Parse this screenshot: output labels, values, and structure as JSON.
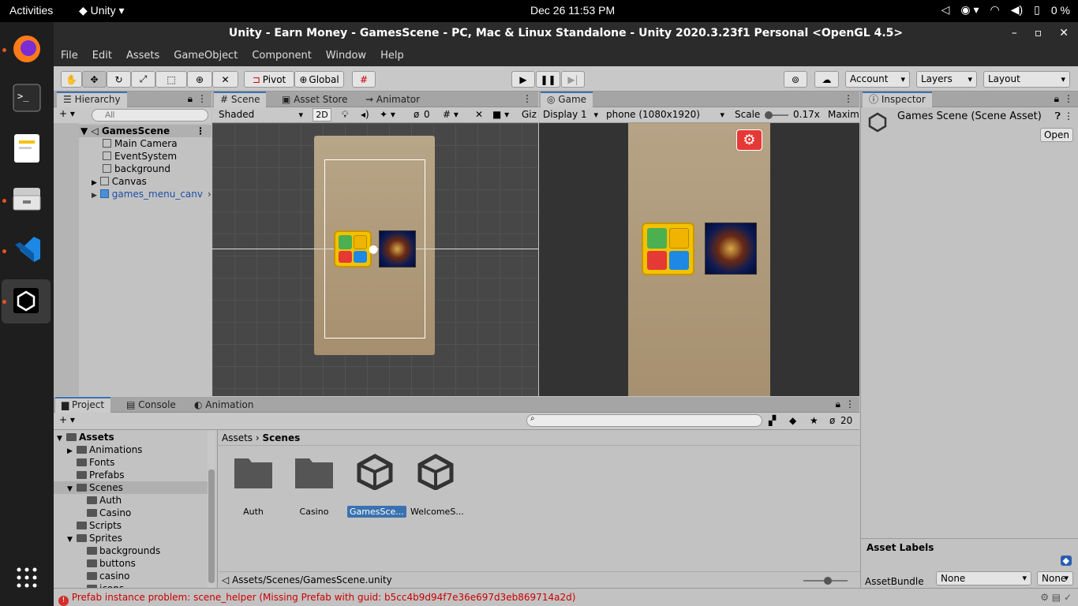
{
  "topbar": {
    "activities": "Activities",
    "app": "Unity",
    "clock": "Dec 26  11:53 PM",
    "battery": "0 %"
  },
  "window": {
    "title": "Unity - Earn Money - GamesScene - PC, Mac & Linux Standalone - Unity 2020.3.23f1 Personal <OpenGL 4.5>"
  },
  "menu": [
    "File",
    "Edit",
    "Assets",
    "GameObject",
    "Component",
    "Window",
    "Help"
  ],
  "toolbar": {
    "pivot": "Pivot",
    "global": "Global",
    "account": "Account",
    "layers": "Layers",
    "layout": "Layout"
  },
  "hierarchy": {
    "tab": "Hierarchy",
    "search_placeholder": "All",
    "scene": "GamesScene",
    "items": [
      "Main Camera",
      "EventSystem",
      "background",
      "Canvas",
      "games_menu_canv"
    ]
  },
  "scene": {
    "tabs": [
      "Scene",
      "Asset Store",
      "Animator"
    ],
    "shading": "Shaded",
    "mode2d": "2D",
    "hidden_count": "0",
    "gizmos": "Giz"
  },
  "game": {
    "tab": "Game",
    "display": "Display 1",
    "resolution": "phone (1080x1920)",
    "scale_label": "Scale",
    "scale_value": "0.17x",
    "maximize": "Maximi"
  },
  "inspector": {
    "tab": "Inspector",
    "title": "Games Scene (Scene Asset)",
    "open": "Open",
    "asset_labels": "Asset Labels",
    "asset_bundle": "AssetBundle",
    "bundle_value": "None",
    "variant_value": "None"
  },
  "project": {
    "tabs": [
      "Project",
      "Console",
      "Animation"
    ],
    "hidden_count": "20",
    "breadcrumb_root": "Assets",
    "breadcrumb_current": "Scenes",
    "path": "Assets/Scenes/GamesScene.unity",
    "tree": [
      {
        "label": "Assets",
        "indent": 0,
        "type": "open"
      },
      {
        "label": "Animations",
        "indent": 1,
        "type": "closed"
      },
      {
        "label": "Fonts",
        "indent": 1,
        "type": "leaf"
      },
      {
        "label": "Prefabs",
        "indent": 1,
        "type": "leaf"
      },
      {
        "label": "Scenes",
        "indent": 1,
        "type": "open"
      },
      {
        "label": "Auth",
        "indent": 2,
        "type": "leaf"
      },
      {
        "label": "Casino",
        "indent": 2,
        "type": "leaf"
      },
      {
        "label": "Scripts",
        "indent": 1,
        "type": "leaf"
      },
      {
        "label": "Sprites",
        "indent": 1,
        "type": "open"
      },
      {
        "label": "backgrounds",
        "indent": 2,
        "type": "leaf"
      },
      {
        "label": "buttons",
        "indent": 2,
        "type": "leaf"
      },
      {
        "label": "casino",
        "indent": 2,
        "type": "leaf"
      },
      {
        "label": "icons",
        "indent": 2,
        "type": "leaf"
      }
    ],
    "assets": [
      {
        "label": "Auth",
        "kind": "folder"
      },
      {
        "label": "Casino",
        "kind": "folder"
      },
      {
        "label": "GamesSce...",
        "kind": "scene"
      },
      {
        "label": "WelcomeS...",
        "kind": "scene"
      }
    ]
  },
  "status": {
    "error": "Prefab instance problem: scene_helper (Missing Prefab with guid: b5cc4b9d94f7e36e697d3eb869714a2d)"
  }
}
